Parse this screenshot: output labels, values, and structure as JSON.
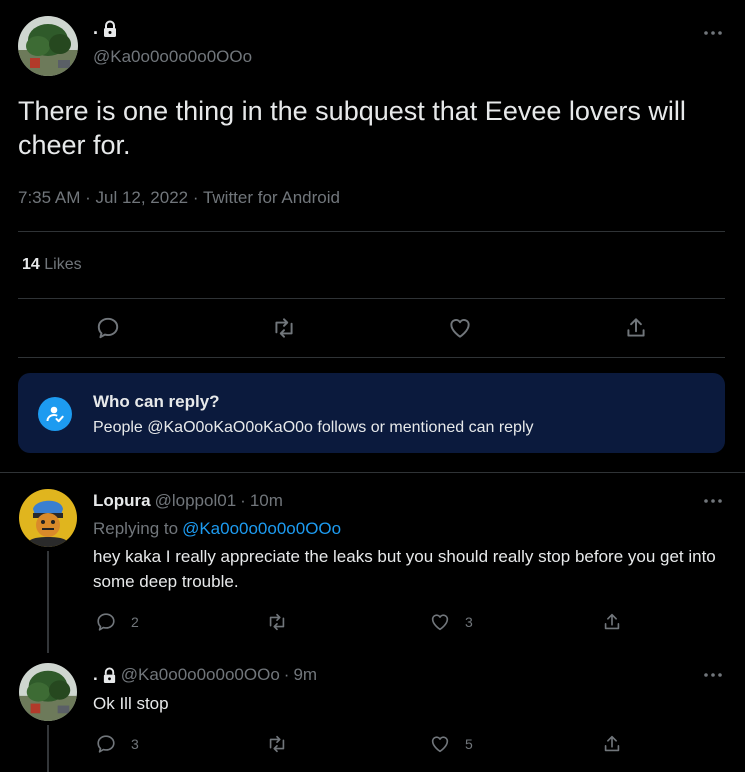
{
  "tweet": {
    "author_name": ".",
    "author_handle": "@Ka0o0o0o0o0OOo",
    "text": "There is one thing in the subquest that Eevee lovers will cheer for.",
    "time": "7:35 AM",
    "date": "Jul 12, 2022",
    "source": "Twitter for Android",
    "likes_count": "14",
    "likes_label": "Likes"
  },
  "who_can_reply": {
    "title": "Who can reply?",
    "description": "People @KaO0oKaO0oKaO0o follows or mentioned can reply"
  },
  "replies": [
    {
      "name": "Lopura",
      "handle": "@loppol01",
      "time": "10m",
      "replying_to_label": "Replying to",
      "replying_to": "@Ka0o0o0o0o0OOo",
      "text": "hey kaka I really appreciate the leaks but you should really stop before you get into some deep trouble.",
      "reply_count": "2",
      "like_count": "3"
    },
    {
      "name": ".",
      "handle": "@Ka0o0o0o0o0OOo",
      "time": "9m",
      "text": "Ok Ill stop",
      "reply_count": "3",
      "like_count": "5"
    }
  ],
  "icons": {
    "reply": "comment-icon",
    "retweet": "retweet-icon",
    "like": "heart-icon",
    "share": "share-icon",
    "more": "more-icon",
    "lock": "lock-icon"
  },
  "colors": {
    "background": "#000000",
    "text": "#e7e9ea",
    "muted": "#71767b",
    "accent": "#1d9bf0",
    "notice_bg": "#0b1a3d"
  }
}
